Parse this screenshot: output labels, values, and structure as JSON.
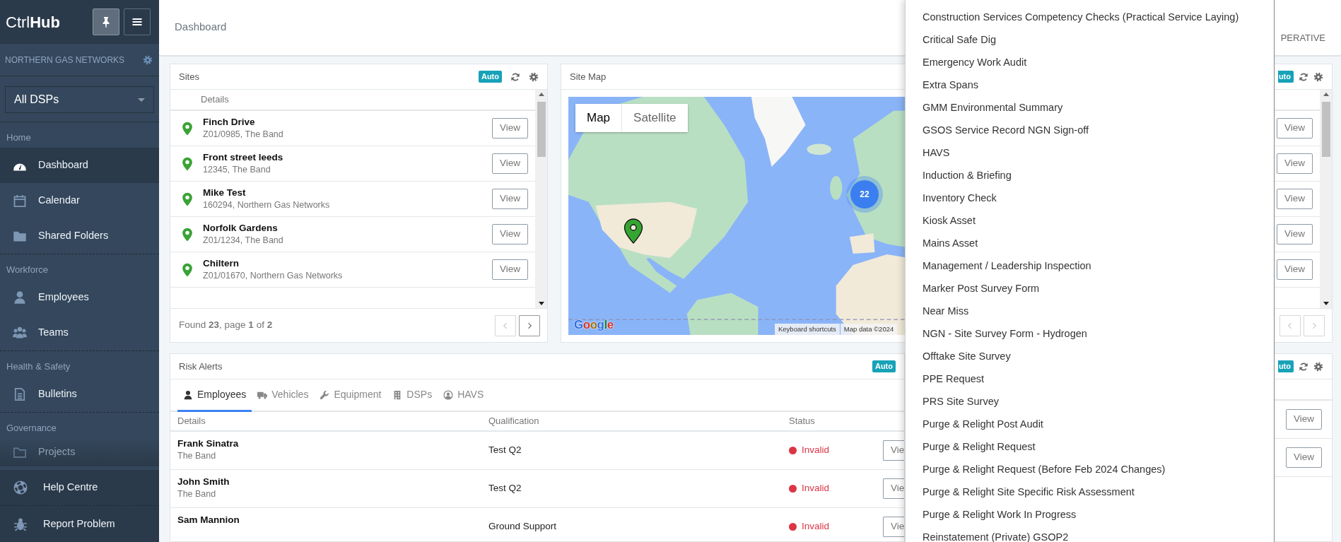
{
  "sidebar": {
    "logo": "Ctrl**Hub**",
    "pinned": true,
    "org": "NORTHERN GAS NETWORKS",
    "dsp_select": "All DSPs",
    "sections": [
      {
        "label": "Home",
        "items": [
          {
            "label": "Dashboard",
            "selected": true
          },
          {
            "label": "Calendar",
            "selected": false
          },
          {
            "label": "Shared Folders",
            "selected": false
          }
        ]
      },
      {
        "label": "Workforce",
        "items": [
          {
            "label": "Employees",
            "selected": false
          },
          {
            "label": "Teams",
            "selected": false
          }
        ]
      },
      {
        "label": "Health & Safety",
        "items": [
          {
            "label": "Bulletins",
            "selected": false
          }
        ]
      },
      {
        "label": "Governance",
        "items": [
          {
            "label": "Projects",
            "selected": false
          }
        ]
      }
    ],
    "footer": [
      {
        "label": "Help Centre"
      },
      {
        "label": "Report Problem"
      }
    ]
  },
  "header": {
    "title": "Dashboard",
    "role": "PERATIVE"
  },
  "sites": {
    "title": "Sites",
    "badge": "Auto",
    "column": "Details",
    "rows": [
      {
        "name": "Finch Drive",
        "detail": "Z01/0985, The Band",
        "action": "View"
      },
      {
        "name": "Front street leeds",
        "detail": "12345, The Band",
        "action": "View"
      },
      {
        "name": "Mike Test",
        "detail": "160294, Northern Gas Networks",
        "action": "View"
      },
      {
        "name": "Norfolk Gardens",
        "detail": "Z01/1234, The Band",
        "action": "View"
      },
      {
        "name": "Chiltern",
        "detail": "Z01/01670, Northern Gas Networks",
        "action": "View"
      }
    ],
    "footer": "Found **23**, page **1** of **2**",
    "pager": [
      {
        "disabled": true
      },
      {
        "disabled": false
      }
    ]
  },
  "site_map": {
    "title": "Site Map",
    "map_types": [
      {
        "label": "Map",
        "selected": true
      },
      {
        "label": "Satellite",
        "selected": false
      }
    ],
    "cluster": "22",
    "logo": "Google",
    "attribution": [
      "Keyboard shortcuts",
      "Map data ©2024"
    ]
  },
  "side_panel": {
    "badge": "uto",
    "actions": [
      "View",
      "View",
      "View",
      "View",
      "View"
    ],
    "pager": [
      {
        "disabled": true
      },
      {
        "disabled": true
      }
    ]
  },
  "risk_alerts": {
    "title": "Risk Alerts",
    "badge": "Auto",
    "tabs": [
      {
        "label": "Employees",
        "selected": true
      },
      {
        "label": "Vehicles",
        "selected": false
      },
      {
        "label": "Equipment",
        "selected": false
      },
      {
        "label": "DSPs",
        "selected": false
      },
      {
        "label": "HAVS",
        "selected": false
      }
    ],
    "columns": [
      "Details",
      "Qualification",
      "Status"
    ],
    "rows": [
      {
        "name": "Frank Sinatra",
        "detail": "The Band",
        "qualification": "Test Q2",
        "status": "Invalid",
        "action": "Vie"
      },
      {
        "name": "John Smith",
        "detail": "The Band",
        "qualification": "Test Q2",
        "status": "Invalid",
        "action": "Vie"
      },
      {
        "name": "Sam Mannion",
        "qualification": "Ground Support",
        "status": "Invalid",
        "action": "Vie"
      }
    ]
  },
  "side_panel_lower": {
    "badge": "uto",
    "actions": [
      "View",
      "View"
    ]
  },
  "dropdown": {
    "items": [
      "Construction Services Competency Checks (Practical Service Laying)",
      "Critical Safe Dig",
      "Emergency Work Audit",
      "Extra Spans",
      "GMM Environmental Summary",
      "GSOS Service Record NGN Sign-off",
      "HAVS",
      "Induction & Briefing",
      "Inventory Check",
      "Kiosk Asset",
      "Mains Asset",
      "Management / Leadership Inspection",
      "Marker Post Survey Form",
      "Near Miss",
      "NGN - Site Survey Form - Hydrogen",
      "Offtake Site Survey",
      "PPE Request",
      "PRS Site Survey",
      "Purge & Relight Post Audit",
      "Purge & Relight Request",
      "Purge & Relight Request (Before Feb 2024 Changes)",
      "Purge & Relight Site Specific Risk Assessment",
      "Purge & Relight Work In Progress",
      "Reinstatement (Private) GSOP2"
    ]
  }
}
